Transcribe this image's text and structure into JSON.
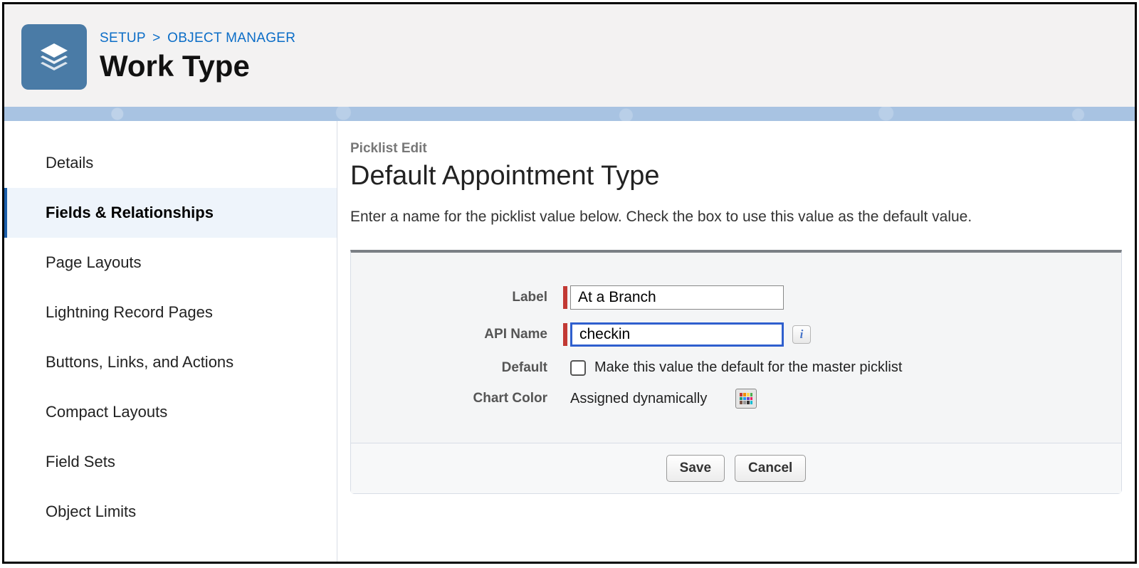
{
  "breadcrumb": {
    "setup": "SETUP",
    "sep": ">",
    "object_manager": "OBJECT MANAGER"
  },
  "page_title": "Work Type",
  "sidebar": {
    "items": [
      {
        "label": "Details"
      },
      {
        "label": "Fields & Relationships"
      },
      {
        "label": "Page Layouts"
      },
      {
        "label": "Lightning Record Pages"
      },
      {
        "label": "Buttons, Links, and Actions"
      },
      {
        "label": "Compact Layouts"
      },
      {
        "label": "Field Sets"
      },
      {
        "label": "Object Limits"
      }
    ],
    "active_index": 1
  },
  "main": {
    "subheading": "Picklist Edit",
    "title": "Default Appointment Type",
    "intro": "Enter a name for the picklist value below. Check the box to use this value as the default value.",
    "form": {
      "label_field": {
        "label": "Label",
        "value": "At a Branch"
      },
      "api_name_field": {
        "label": "API Name",
        "value": "checkin"
      },
      "default_field": {
        "label": "Default",
        "checkbox_label": "Make this value the default for the master picklist",
        "checked": false
      },
      "chart_color_field": {
        "label": "Chart Color",
        "value": "Assigned dynamically"
      }
    },
    "buttons": {
      "save": "Save",
      "cancel": "Cancel"
    }
  }
}
